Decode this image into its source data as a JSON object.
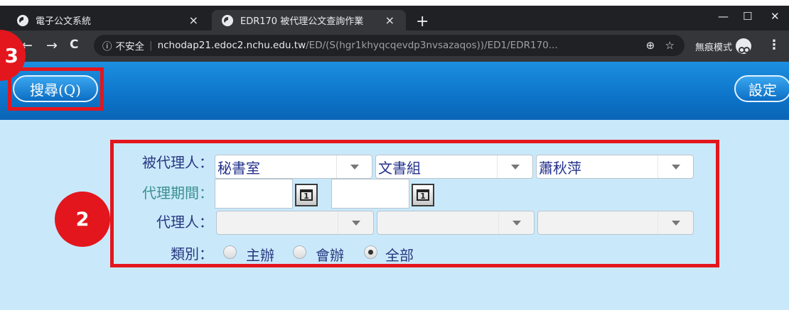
{
  "browser": {
    "tabs": [
      {
        "title": "電子公文系統",
        "close": "×"
      },
      {
        "title": "EDR170 被代理公文查詢作業",
        "close": "×"
      }
    ],
    "new_tab": "+",
    "window_controls": {
      "minimize": "—",
      "maximize": "☐",
      "close": "✕"
    },
    "nav": {
      "back": "←",
      "forward": "→",
      "reload": "C"
    },
    "address": {
      "security_icon": "ⓘ",
      "security_text": "不安全",
      "host": "nchodap21.edoc2.nchu.edu.tw",
      "path": "/ED/(S(hgr1khyqcqevdp3nvsazaqos))/ED1/EDR170..."
    },
    "incognito_label": "無痕模式",
    "menu": "⋮"
  },
  "toolbar": {
    "search_label": "搜尋(Q)",
    "settings_label": "設定"
  },
  "annotations": {
    "badge3": "3",
    "badge2": "2",
    "box_color": "#e3161d"
  },
  "form": {
    "principal_label": "被代理人：",
    "principal_values": [
      "秘書室",
      "文書組",
      "蕭秋萍"
    ],
    "period_label": "代理期間：",
    "period_start": "",
    "period_end": "",
    "agent_label": "代理人：",
    "agent_values": [
      "",
      "",
      ""
    ],
    "type_label": "類別：",
    "type_options": [
      "主辦",
      "會辦",
      "全部"
    ],
    "type_selected": "全部"
  }
}
